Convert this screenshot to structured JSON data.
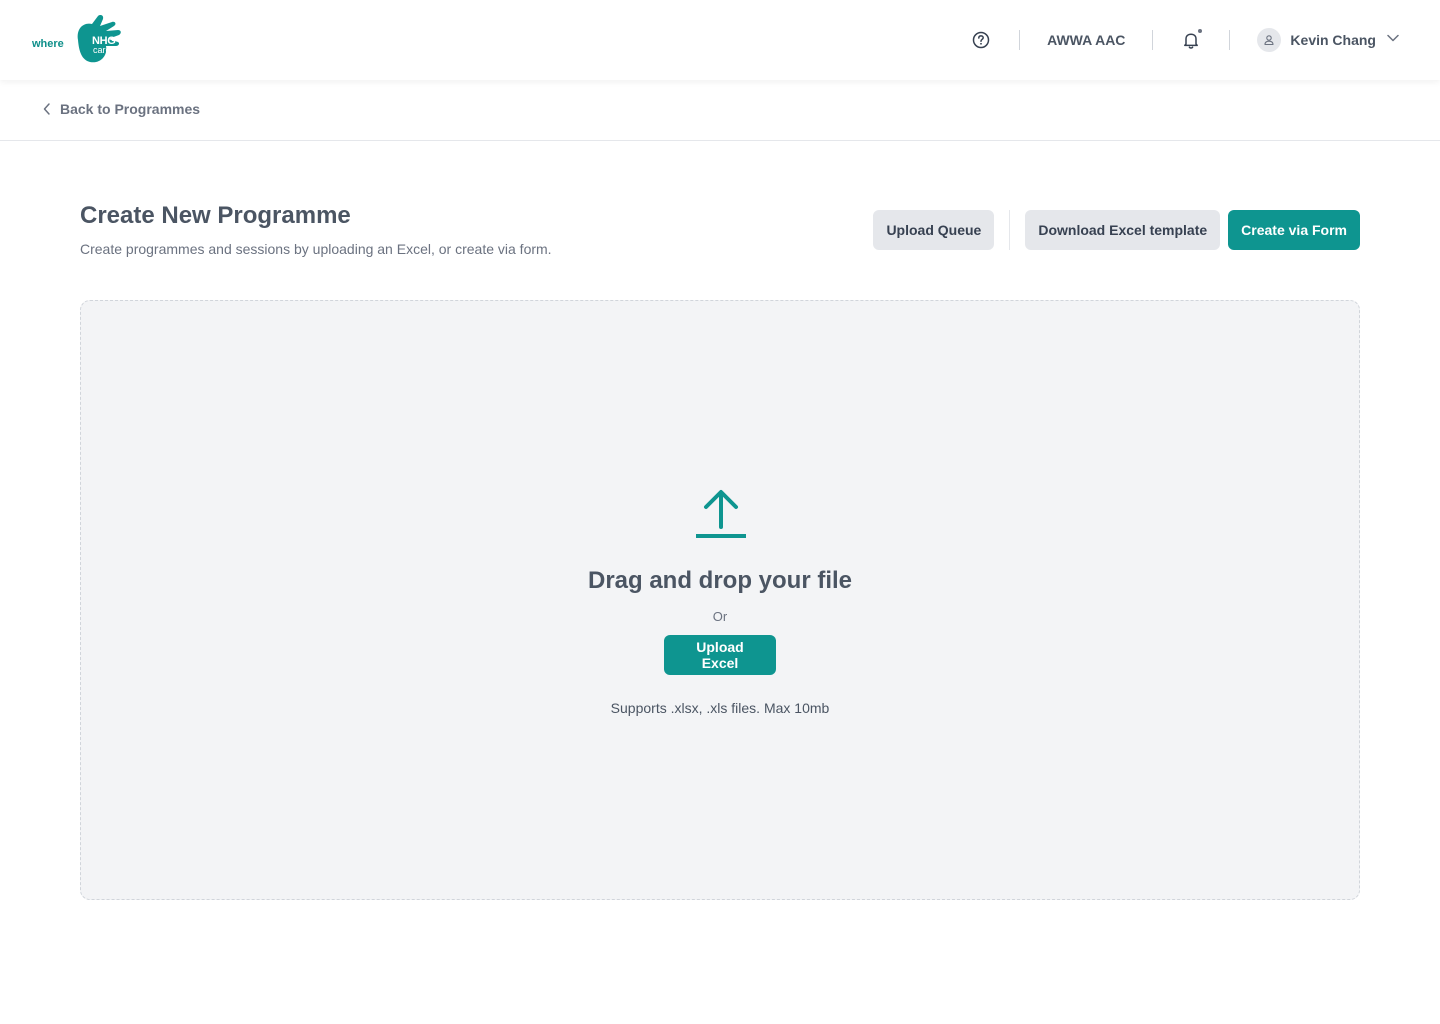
{
  "brand": {
    "where_text": "where",
    "nhg_text": "NHG",
    "cares_text": "cares",
    "accent_color": "#0e9590"
  },
  "header": {
    "help_icon": "question-circle-icon",
    "org_name": "AWWA AAC",
    "notification_icon": "bell-icon",
    "user": {
      "name": "Kevin Chang",
      "avatar_icon": "user-icon",
      "menu_icon": "chevron-down-icon"
    }
  },
  "breadcrumb": {
    "back_label": "Back to Programmes",
    "back_icon": "chevron-left-icon"
  },
  "page": {
    "title": "Create New Programme",
    "subtitle": "Create programmes and sessions by uploading an Excel, or create via form."
  },
  "actions": {
    "upload_queue_label": "Upload Queue",
    "download_template_label": "Download Excel template",
    "create_form_label": "Create via Form"
  },
  "dropzone": {
    "icon": "upload-arrow-icon",
    "title": "Drag and drop your file",
    "or_text": "Or",
    "upload_button_label": "Upload Excel",
    "note": "Supports .xlsx, .xls files. Max 10mb"
  }
}
